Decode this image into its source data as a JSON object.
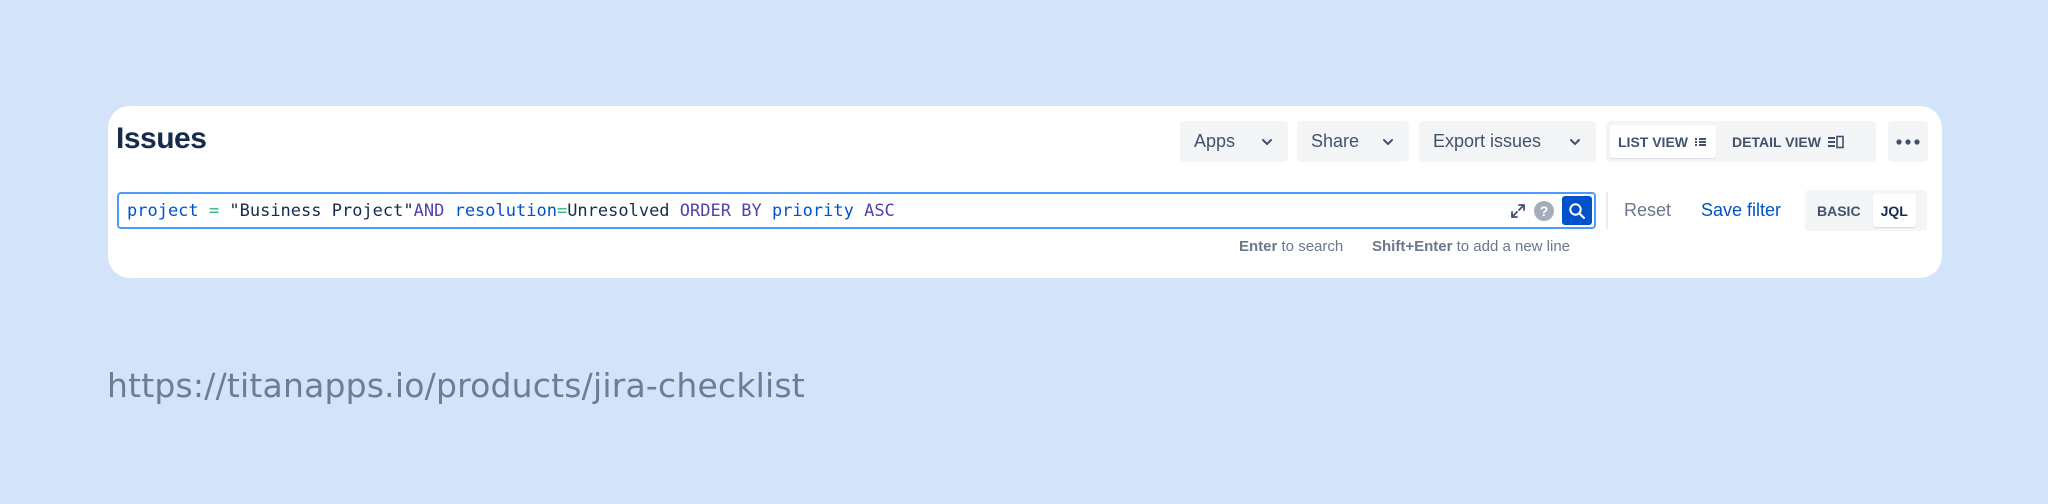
{
  "header": {
    "title": "Issues"
  },
  "toolbar": {
    "apps_label": "Apps",
    "share_label": "Share",
    "export_label": "Export issues",
    "list_view_label": "LIST VIEW",
    "detail_view_label": "DETAIL VIEW",
    "more_icon": "ellipsis-icon"
  },
  "search": {
    "jql_tokens": [
      {
        "text": "project",
        "kind": "field"
      },
      {
        "text": " = ",
        "kind": "op"
      },
      {
        "text": "\"Business Project\"",
        "kind": "str"
      },
      {
        "text": "AND",
        "kind": "and"
      },
      {
        "text": " ",
        "kind": "str"
      },
      {
        "text": "resolution",
        "kind": "field"
      },
      {
        "text": "=",
        "kind": "op"
      },
      {
        "text": "Unresolved",
        "kind": "val"
      },
      {
        "text": " ",
        "kind": "str"
      },
      {
        "text": "ORDER BY",
        "kind": "and"
      },
      {
        "text": " ",
        "kind": "str"
      },
      {
        "text": "priority",
        "kind": "field"
      },
      {
        "text": " ",
        "kind": "str"
      },
      {
        "text": "ASC",
        "kind": "and"
      }
    ],
    "hint_enter_key": "Enter",
    "hint_enter_text": " to search",
    "hint_shift_key": "Shift+Enter",
    "hint_shift_text": " to add a new line",
    "help_glyph": "?"
  },
  "actions": {
    "reset_label": "Reset",
    "save_filter_label": "Save filter",
    "basic_label": "BASIC",
    "jql_label": "JQL"
  },
  "footer": {
    "url": "https://titanapps.io/products/jira-checklist"
  },
  "colors": {
    "background": "#d3e3f8",
    "accent": "#0052cc",
    "focus_border": "#4c9aff"
  }
}
